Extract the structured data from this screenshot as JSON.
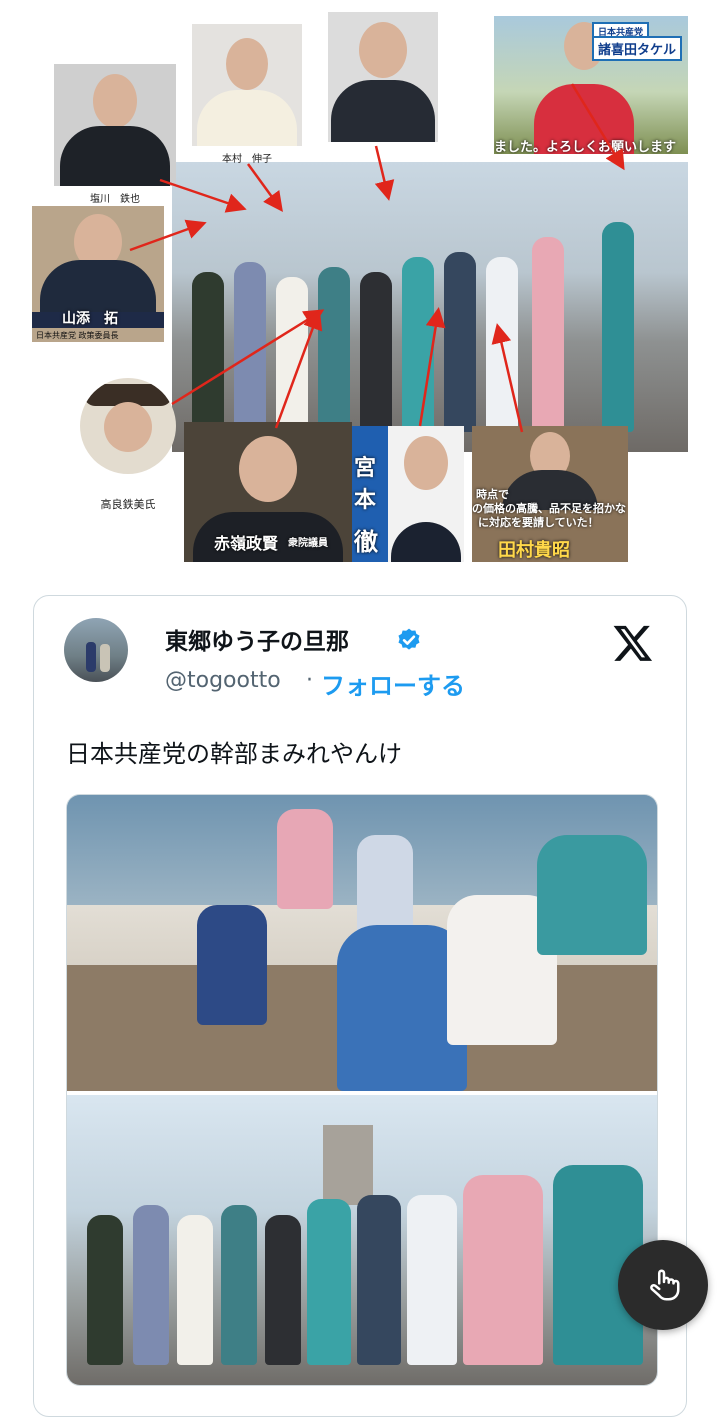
{
  "collage": {
    "captions": {
      "shiokawa": "塩川　鉄也",
      "motomura": "本村　伸子",
      "yamazoe_name": "山添　拓",
      "yamazoe_sub": "日本共産党 政策委員長",
      "takara": "高良鉄美氏",
      "akamine": "赤嶺政賢",
      "akamine_sub": "衆院議員",
      "miyamoto": "宮本",
      "miyamoto2": "徹",
      "tamura": "田村貴昭",
      "tamura_overlay1": "時点で",
      "tamura_overlay2": "の価格の高騰、品不足を招かな",
      "tamura_overlay3": "に対応を要請していた！",
      "morokita_party": "日本共産党",
      "morokita_name": "諸喜田タケル",
      "morokita_sub": "ました。よろしくお願いします"
    }
  },
  "tweet": {
    "display_name": "東郷ゆう子の旦那",
    "handle": "@togootto",
    "separator": "·",
    "follow_label": "フォローする",
    "text": "日本共産党の幹部まみれやんけ"
  },
  "colors": {
    "accent": "#1d9bf0",
    "arrow": "#e0261b",
    "border": "#cfd9de"
  },
  "icons": [
    "verified-badge-icon",
    "x-logo-icon",
    "hand-pointer-icon"
  ]
}
